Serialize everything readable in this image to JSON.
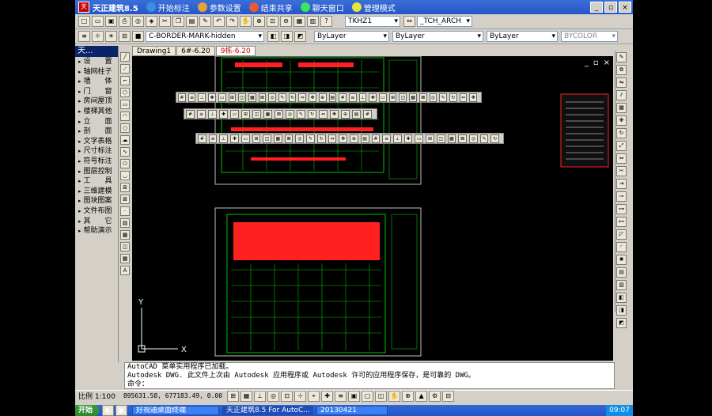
{
  "titlebar": {
    "title": "天正建筑8.5",
    "buttons": [
      {
        "label": "开始标注",
        "color": "#3a8ee6"
      },
      {
        "label": "参数设置",
        "color": "#e6a23a"
      },
      {
        "label": "结束共享",
        "color": "#e65a3a"
      },
      {
        "label": "聊天窗口",
        "color": "#3ae65a"
      },
      {
        "label": "管理模式",
        "color": "#e6e63a"
      }
    ]
  },
  "toolbar": {
    "textstyle": "TKHZ1",
    "dimstyle": "_TCH_ARCH",
    "layer_current": "C-BORDER-MARK-hidden",
    "color": "ByLayer",
    "linetype": "ByLayer",
    "lineweight": "ByLayer",
    "plotstyle": "BYCOLOR"
  },
  "sidebar": {
    "header": "天...",
    "items": [
      {
        "label": "设　　置"
      },
      {
        "label": "轴网柱子"
      },
      {
        "label": "墙　　体"
      },
      {
        "label": "门　　窗"
      },
      {
        "label": "房间屋顶"
      },
      {
        "label": "楼梯其他"
      },
      {
        "label": "立　　面"
      },
      {
        "label": "剖　　面"
      },
      {
        "label": "文字表格"
      },
      {
        "label": "尺寸标注"
      },
      {
        "label": "符号标注"
      },
      {
        "label": "图层控制"
      },
      {
        "label": "工　　具"
      },
      {
        "label": "三维建模"
      },
      {
        "label": "图块图案"
      },
      {
        "label": "文件布图"
      },
      {
        "label": "其　　它"
      },
      {
        "label": "帮助演示"
      }
    ]
  },
  "tabs": [
    {
      "label": "Drawing1"
    },
    {
      "label": "6#-6.20"
    },
    {
      "label": "9栋-6.20"
    }
  ],
  "command": {
    "line1": "AutoCAD 菜单实用程序已加载。",
    "line2": "Autodesk DWG.  此文件上次由 Autodesk 应用程序或 Autodesk 许可的应用程序保存，是可靠的 DWG。",
    "prompt": "命令："
  },
  "status": {
    "scale": "比例 1:100",
    "coords": "895631.58, 677183.49, 0.00"
  },
  "taskbar": {
    "start": "开始",
    "tasks": [
      {
        "label": "好视通桌面终端"
      },
      {
        "label": "天正建筑8.5 For AutoC..."
      },
      {
        "label": "20130421"
      }
    ],
    "clock": "09:07"
  },
  "ucs": {
    "x": "X",
    "y": "Y"
  },
  "canvas_window": {
    "min": "_",
    "max": "▫",
    "close": "×"
  },
  "colors": {
    "accent": "#2556c7",
    "canvas": "#000000",
    "plan_green": "#00c000",
    "plan_red": "#ff2020"
  }
}
